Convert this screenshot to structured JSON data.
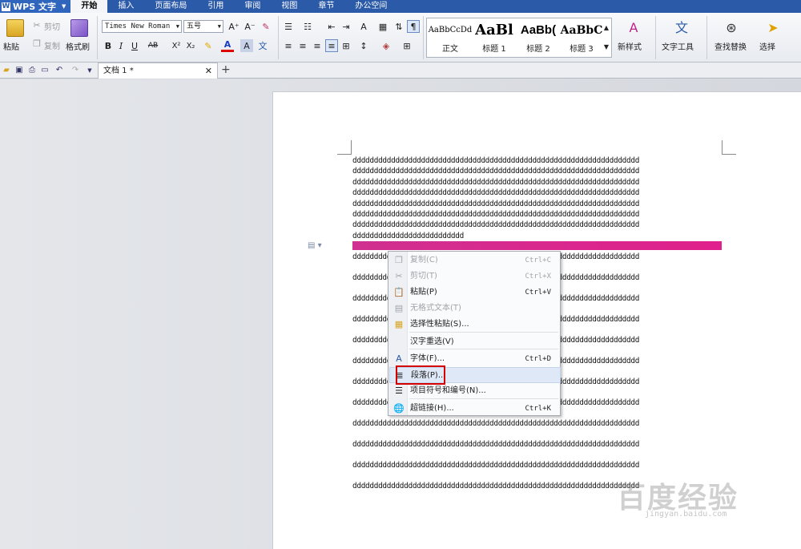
{
  "app": {
    "logo_text": "WPS 文字",
    "menu_tabs": [
      {
        "label": "开始"
      },
      {
        "label": "插入"
      },
      {
        "label": "页面布局"
      },
      {
        "label": "引用"
      },
      {
        "label": "审阅"
      },
      {
        "label": "视图"
      },
      {
        "label": "章节"
      },
      {
        "label": "办公空间"
      }
    ]
  },
  "ribbon": {
    "paste": "粘贴",
    "cut": "剪切",
    "copy": "复制",
    "format_painter": "格式刷",
    "font_name": "Times New Roman",
    "font_size": "五号",
    "bold": "B",
    "italic": "I",
    "underline": "U",
    "strike": "AB",
    "superscript": "X²",
    "subscript": "X₂",
    "grow_font": "A⁺",
    "shrink_font": "A⁻",
    "styles": [
      {
        "preview": "AaBbCcDd",
        "label": "正文"
      },
      {
        "preview": "AaBl",
        "label": "标题 1"
      },
      {
        "preview": "AaBb(",
        "label": "标题 2"
      },
      {
        "preview": "AaBbC",
        "label": "标题 3"
      }
    ],
    "new_style": "新样式",
    "text_tools": "文字工具",
    "find_replace": "查找替换",
    "select": "选择"
  },
  "tabs": {
    "doc_title": "文档 1 *"
  },
  "document": {
    "lines": [
      "ddddddddddddddddddddddddddddddddddddddddddddddddddddddddddddddddddd",
      "ddddddddddddddddddddddddddddddddddddddddddddddddddddddddddddddddddd",
      "ddddddddddddddddddddddddddddddddddddddddddddddddddddddddddddddddddd",
      "ddddddddddddddddddddddddddddddddddddddddddddddddddddddddddddddddddd",
      "ddddddddddddddddddddddddddddddddddddddddddddddddddddddddddddddddddd",
      "ddddddddddddddddddddddddddddddddddddddddddddddddddddddddddddddddddd",
      "ddddddddddddddddddddddddddddddddddddddddddddddddddddddddddddddddddd",
      "dddddddddddddddddddddddddd"
    ],
    "lower_lines": [
      "ddddddddddddddddddddddddddddddddddddddddddddddddddddddddddddddddddd",
      "ddddddddddddddddddddddddddddddddddddddddddddddddddddddddddddddddddd",
      "ddddddddddddddddddddddddddddddddddddddddddddddddddddddddddddddddddd",
      "ddddddddddddddddddddddddddddddddddddddddddddddddddddddddddddddddddd",
      "ddddddddddddddddddddddddddddddddddddddddddddddddddddddddddddddddddd",
      "ddddddddddddddddddddddddddddddddddddddddddddddddddddddddddddddddddd",
      "ddddddddddddddddddddddddddddddddddddddddddddddddddddddddddddddddddd",
      "ddddddddddddddddddddddddddddddddddddddddddddddddddddddddddddddddddd",
      "ddddddddddddddddddddddddddddddddddddddddddddddddddddddddddddddddddd",
      "ddddddddddddddddddddddddddddddddddddddddddddddddddddddddddddddddddd",
      "ddddddddddddddddddddddddddddddddddddddddddddddddddddddddddddddddddd",
      "ddddddddddddddddddddddddddddddddddddddddddddddddddddddddddddddddddd"
    ]
  },
  "context_menu": {
    "items": [
      {
        "icon": "copy-icon",
        "label": "复制(C)",
        "shortcut": "Ctrl+C",
        "disabled": true
      },
      {
        "icon": "scissors-icon",
        "label": "剪切(T)",
        "shortcut": "Ctrl+X",
        "disabled": true
      },
      {
        "icon": "paste-icon",
        "label": "粘贴(P)",
        "shortcut": "Ctrl+V",
        "disabled": false
      },
      {
        "icon": "plain-paste-icon",
        "label": "无格式文本(T)",
        "shortcut": "",
        "disabled": true
      },
      {
        "icon": "paste-special-icon",
        "label": "选择性粘贴(S)...",
        "shortcut": "",
        "disabled": false
      },
      {
        "icon": "",
        "label": "汉字重选(V)",
        "shortcut": "",
        "disabled": false
      },
      {
        "icon": "font-icon",
        "label": "字体(F)...",
        "shortcut": "Ctrl+D",
        "disabled": false
      },
      {
        "icon": "paragraph-icon",
        "label": "段落(P)...",
        "shortcut": "",
        "disabled": false
      },
      {
        "icon": "bullets-icon",
        "label": "项目符号和编号(N)...",
        "shortcut": "",
        "disabled": false
      },
      {
        "icon": "hyperlink-icon",
        "label": "超链接(H)...",
        "shortcut": "Ctrl+K",
        "disabled": false
      }
    ]
  },
  "watermark": {
    "text": "百度经验",
    "sub": "jingyan.baidu.com"
  },
  "colors": {
    "accent": "#2a5aa8",
    "highlight": "#d8288e",
    "callout": "#d40000"
  }
}
